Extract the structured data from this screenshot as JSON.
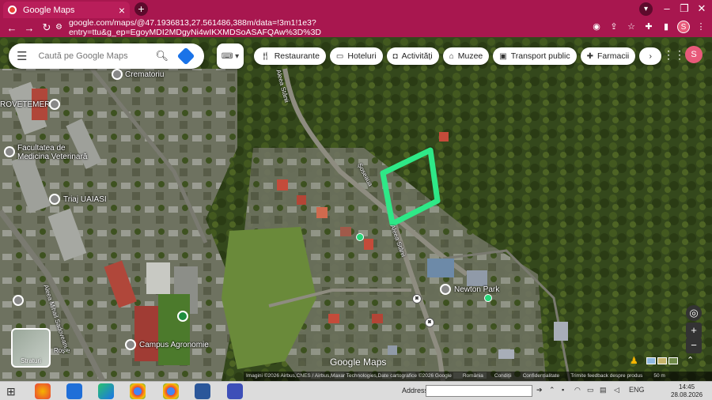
{
  "browser": {
    "tab_title": "Google Maps",
    "tab_close": "×",
    "new_tab": "+",
    "url": "google.com/maps/@47.1936813,27.561486,388m/data=!3m1!1e3?entry=ttu&g_ep=EgoyMDI2MDgyNi4wIKXMDSoASAFQAw%3D%3D",
    "profile_initial": "S"
  },
  "search": {
    "placeholder": "Caută pe Google Maps"
  },
  "chips": [
    {
      "label": "Restaurante",
      "icon": "fork-knife-icon"
    },
    {
      "label": "Hoteluri",
      "icon": "bed-icon"
    },
    {
      "label": "Activități",
      "icon": "camera-icon"
    },
    {
      "label": "Muzee",
      "icon": "museum-icon"
    },
    {
      "label": "Transport public",
      "icon": "bus-icon"
    },
    {
      "label": "Farmacii",
      "icon": "pill-icon"
    }
  ],
  "map_labels": {
    "crematoriu": "Crematoriu",
    "rovetemerg": "ROVETEMERG",
    "facultatea": "Facultatea de Medicina Veterinară",
    "triaj": "Triaj UAIASI",
    "campus": "Campus Agronomie",
    "newton": "Newton Park",
    "street_stanii": "Aleea Stânii",
    "street_sadoveanu": "Aleea Mihail Sadoveanu",
    "street_rosie": "Roșie",
    "street_soseaua": "Șoseaua",
    "street_aleea_stanii2": "Aleea Stânii"
  },
  "layers_label": "Straturi",
  "brand": "Google Maps",
  "attribution": [
    "Imagini ©2026 Airbus,CNES / Airbus,Maxar Technologies,Date cartografice ©2026 Google",
    "România",
    "Condiții",
    "Confidențialitate",
    "Trimite feedback despre produs",
    "50 m"
  ],
  "taskbar": {
    "address_label": "Address",
    "lang": "ENG",
    "time": "14:45",
    "date": "28.08.2026"
  },
  "colors": {
    "browser_bg": "#a8174f",
    "highlight": "#2ee887"
  }
}
